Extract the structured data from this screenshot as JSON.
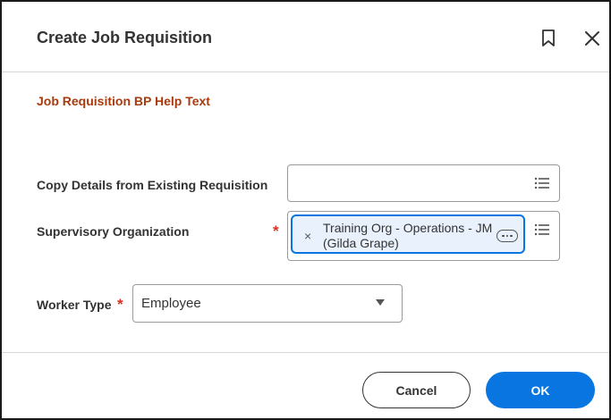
{
  "dialog": {
    "title": "Create Job Requisition",
    "help_link": "Job Requisition BP Help Text"
  },
  "icons": {
    "bookmark": "bookmark-icon",
    "close": "close-icon",
    "prompt_list": "list-icon",
    "remove": "x-icon",
    "more": "ellipsis-icon",
    "dropdown": "caret-down-icon"
  },
  "fields": {
    "copy_details": {
      "label": "Copy Details from Existing Requisition",
      "value": ""
    },
    "supervisory_org": {
      "label": "Supervisory Organization",
      "required_mark": "*",
      "selected": "Training Org - Operations - JM (Gilda Grape)",
      "remove_glyph": "×"
    },
    "worker_type": {
      "label": "Worker Type",
      "required_mark": "*",
      "value": "Employee"
    }
  },
  "footer": {
    "cancel_label": "Cancel",
    "ok_label": "OK"
  },
  "colors": {
    "accent": "#0875e1",
    "required": "#de2e21",
    "help_link": "#a83a0e",
    "selected_pill_bg": "#e9f2fc"
  }
}
